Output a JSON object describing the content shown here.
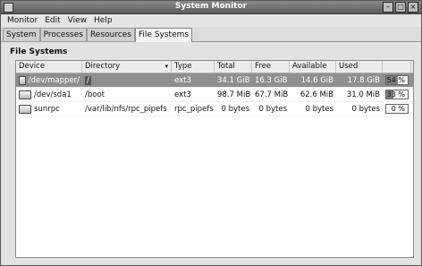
{
  "window": {
    "title": "System Monitor"
  },
  "menu": [
    "Monitor",
    "Edit",
    "View",
    "Help"
  ],
  "tabs": [
    "System",
    "Processes",
    "Resources",
    "File Systems"
  ],
  "section": {
    "title": "File Systems"
  },
  "columns": [
    "Device",
    "Directory",
    "Type",
    "Total",
    "Free",
    "Available",
    "Used"
  ],
  "rows": [
    {
      "device": "/dev/mapper/",
      "directory": "/",
      "type": "ext3",
      "total": "34.1 GiB",
      "free": "16.3 GiB",
      "available": "14.6 GiB",
      "used": "17.8 GiB",
      "usage": "54",
      "usage_label": "54 %",
      "selected": true
    },
    {
      "device": "/dev/sda1",
      "directory": "/boot",
      "type": "ext3",
      "total": "98.7 MiB",
      "free": "67.7 MiB",
      "available": "62.6 MiB",
      "used": "31.0 MiB",
      "usage": "33",
      "usage_label": "33 %"
    },
    {
      "device": "sunrpc",
      "directory": "/var/lib/nfs/rpc_pipefs",
      "type": "rpc_pipefs",
      "total": "0 bytes",
      "free": "0 bytes",
      "available": "0 bytes",
      "used": "0 bytes",
      "usage": "0",
      "usage_label": "0 %"
    }
  ]
}
